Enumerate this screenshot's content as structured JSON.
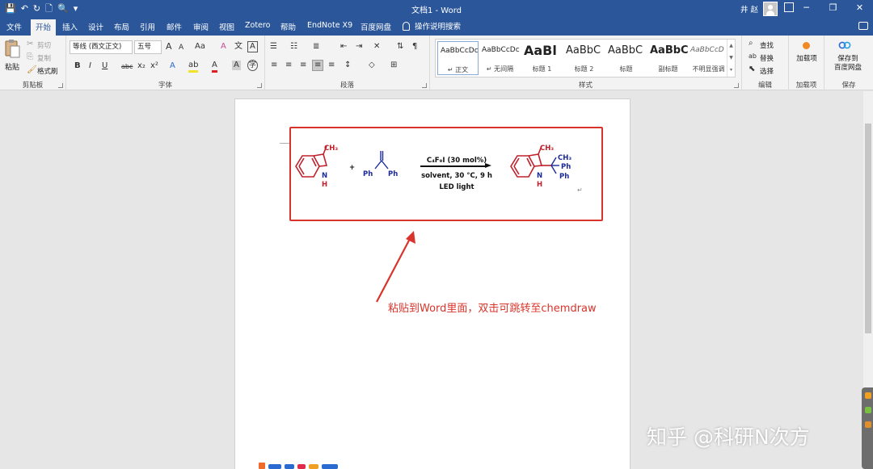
{
  "window": {
    "title": "文档1 - Word",
    "user_name": "井 赵",
    "controls": {
      "minimize": "─",
      "maximize": "❐",
      "close": "✕"
    }
  },
  "qat": {
    "save": "💾",
    "undo": "↶",
    "redo": "↻",
    "new": "🗋",
    "print_preview": "🔍",
    "more": "▾"
  },
  "tabs": [
    "文件",
    "开始",
    "插入",
    "设计",
    "布局",
    "引用",
    "邮件",
    "审阅",
    "视图",
    "Zotero",
    "帮助",
    "EndNote X9",
    "百度网盘"
  ],
  "tell_me": "操作说明搜索",
  "ribbon": {
    "clipboard": {
      "label": "剪贴板",
      "paste": "粘贴",
      "cut": "剪切",
      "copy": "复制",
      "format_painter": "格式刷"
    },
    "font": {
      "label": "字体",
      "font_name": "等线 (西文正文)",
      "font_size": "五号",
      "grow": "A",
      "shrink": "A",
      "case": "Aa",
      "clear": "A",
      "pinyin": "文",
      "border_char": "A",
      "bold": "B",
      "italic": "I",
      "underline": "U",
      "strike": "abc",
      "subscript": "x₂",
      "superscript": "x²",
      "text_effects": "A",
      "highlight": "ab",
      "font_color": "A",
      "shading": "A",
      "enclose": "字"
    },
    "paragraph": {
      "label": "段落"
    },
    "styles": {
      "label": "样式",
      "items": [
        {
          "sample": "AaBbCcDc",
          "name": "↵ 正文"
        },
        {
          "sample": "AaBbCcDc",
          "name": "↵ 无间隔"
        },
        {
          "sample": "AaBl",
          "name": "标题 1"
        },
        {
          "sample": "AaBbC",
          "name": "标题 2"
        },
        {
          "sample": "AaBbC",
          "name": "标题"
        },
        {
          "sample": "AaBbC",
          "name": "副标题"
        },
        {
          "sample": "AaBbCcD",
          "name": "不明显强调"
        }
      ]
    },
    "editing": {
      "label": "编辑",
      "find": "查找",
      "replace": "替换",
      "select": "选择"
    },
    "addins": {
      "label": "加载项",
      "button": "加载项"
    },
    "save": {
      "label": "保存",
      "button_line1": "保存到",
      "button_line2": "百度网盘"
    }
  },
  "document": {
    "scheme": {
      "reactant1_substituent": "CH₃",
      "reactant1_nh": "N",
      "reactant1_h": "H",
      "plus": "+",
      "reactant2_ph_left": "Ph",
      "reactant2_ph_right": "Ph",
      "catalyst": "C₄F₉I (30 mol%)",
      "conditions": "solvent, 30 °C, 9 h",
      "light": "LED light",
      "product_ch3": "CH₃",
      "product_side_ch3": "CH₃",
      "product_ph1": "Ph",
      "product_ph2": "Ph",
      "product_nh": "N",
      "product_h": "H",
      "paragraph_mark": "↵"
    },
    "annotation": "粘贴到Word里面，双击可跳转至chemdraw"
  },
  "watermark": "知乎 @科研N次方",
  "colors": {
    "title_bar": "#2b579a",
    "annotation": "#d9342b",
    "frame": "#d9342b",
    "reactant_red": "#c0202a",
    "reactant_blue": "#1a2a9a"
  }
}
